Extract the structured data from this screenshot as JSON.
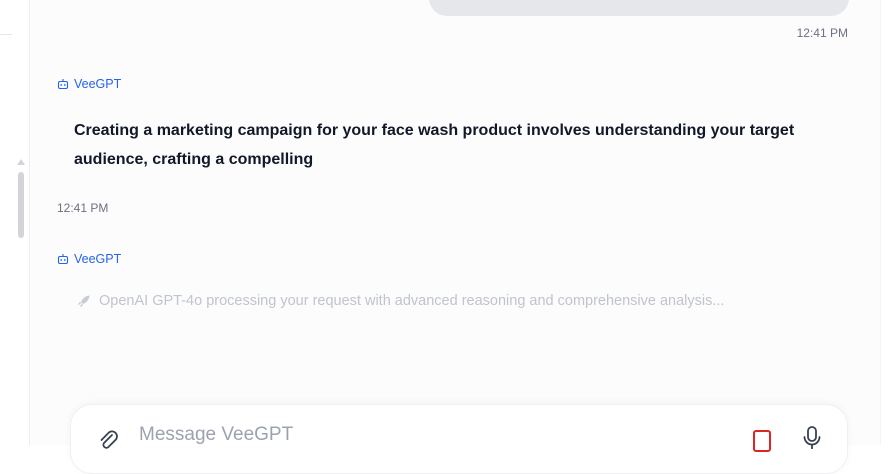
{
  "conversation": {
    "user_message_time": "12:41 PM",
    "messages": [
      {
        "sender": "VeeGPT",
        "text": "Creating a marketing campaign for your face wash product involves understanding your target audience, crafting a compelling",
        "time": "12:41 PM"
      },
      {
        "sender": "VeeGPT",
        "status_text": "OpenAI GPT-4o processing your request with advanced reasoning and comprehensive analysis..."
      }
    ]
  },
  "composer": {
    "placeholder": "Message VeeGPT"
  },
  "icons": {
    "bot": "robot-icon",
    "status": "rocket-icon",
    "attach": "paperclip-icon",
    "stop": "stop-icon",
    "mic": "microphone-icon"
  },
  "colors": {
    "accent": "#2563eb",
    "user_bubble": "#e5e7eb",
    "stop": "#dc2626",
    "muted_text": "#6b7280"
  }
}
